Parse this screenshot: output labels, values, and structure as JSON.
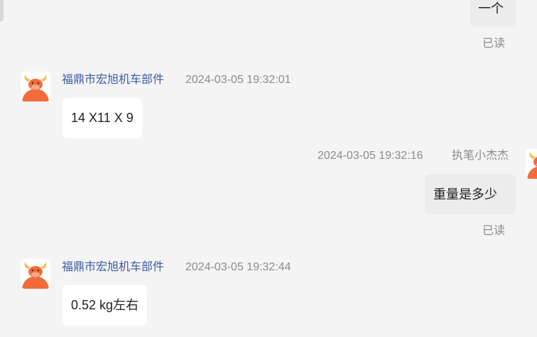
{
  "chat": {
    "messages": [
      {
        "direction": "outgoing",
        "text": "一个",
        "read_status": "已读"
      },
      {
        "direction": "incoming",
        "sender": "福鼎市宏旭机车部件",
        "timestamp": "2024-03-05 19:32:01",
        "text": "14 X11 X 9"
      },
      {
        "direction": "outgoing",
        "sender": "执笔小杰杰",
        "timestamp": "2024-03-05 19:32:16",
        "text": "重量是多少",
        "read_status": "已读"
      },
      {
        "direction": "incoming",
        "sender": "福鼎市宏旭机车部件",
        "timestamp": "2024-03-05 19:32:44",
        "text": "0.52 kg左右"
      }
    ]
  },
  "colors": {
    "background": "#f4f4f4",
    "sender_name": "#3c5aa6",
    "meta_text": "#8c8c8c",
    "incoming_bubble": "#ffffff",
    "outgoing_bubble": "#ececec",
    "avatar_body": "#f26b3a",
    "avatar_horns": "#f5b942"
  },
  "avatar_icon": "bull-cartoon-icon"
}
